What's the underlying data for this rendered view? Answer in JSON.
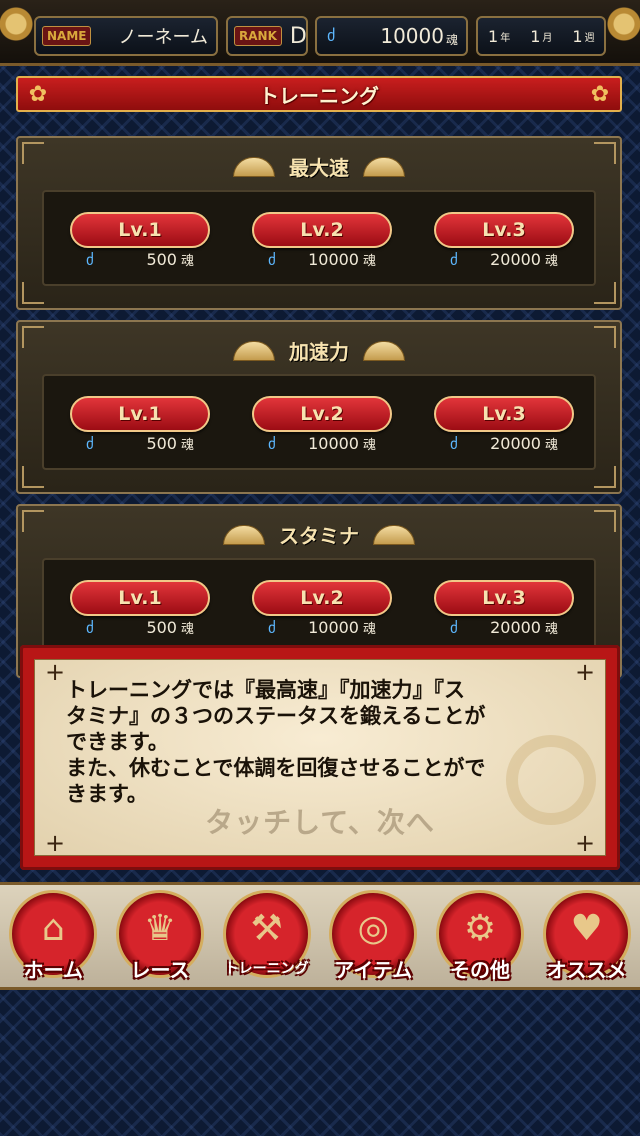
{
  "status": {
    "name_tag": "NAME",
    "name": "ノーネーム",
    "rank_tag": "RANK",
    "rank": "D",
    "souls": "10000",
    "souls_unit": "魂",
    "year": "1",
    "year_unit": "年",
    "month": "1",
    "month_unit": "月",
    "week": "1",
    "week_unit": "週"
  },
  "screen_title": "トレーニング",
  "trainings": [
    {
      "title": "最大速",
      "levels": [
        {
          "label": "Lv.1",
          "cost": "500",
          "unit": "魂"
        },
        {
          "label": "Lv.2",
          "cost": "10000",
          "unit": "魂"
        },
        {
          "label": "Lv.3",
          "cost": "20000",
          "unit": "魂"
        }
      ]
    },
    {
      "title": "加速力",
      "levels": [
        {
          "label": "Lv.1",
          "cost": "500",
          "unit": "魂"
        },
        {
          "label": "Lv.2",
          "cost": "10000",
          "unit": "魂"
        },
        {
          "label": "Lv.3",
          "cost": "20000",
          "unit": "魂"
        }
      ]
    },
    {
      "title": "スタミナ",
      "levels": [
        {
          "label": "Lv.1",
          "cost": "500",
          "unit": "魂"
        },
        {
          "label": "Lv.2",
          "cost": "10000",
          "unit": "魂"
        },
        {
          "label": "Lv.3",
          "cost": "20000",
          "unit": "魂"
        }
      ]
    }
  ],
  "tutorial": {
    "text_line1": "トレーニングでは『最高速』『加速力』『ス",
    "text_line2": "タミナ』の３つのステータスを鍛えることが",
    "text_line3": "できます。",
    "text_line4": "また、休むことで体調を回復させることがで",
    "text_line5": "きます。",
    "next_hint": "タッチして、次へ"
  },
  "nav": [
    {
      "label": "ホーム",
      "icon": "home-icon"
    },
    {
      "label": "レース",
      "icon": "trophy-icon"
    },
    {
      "label": "トレーニング",
      "icon": "dumbbell-icon"
    },
    {
      "label": "アイテム",
      "icon": "coins-icon"
    },
    {
      "label": "その他",
      "icon": "gear-icon"
    },
    {
      "label": "オススメ",
      "icon": "heart-icon"
    }
  ],
  "colors": {
    "accent_red": "#c81e1e",
    "gold": "#d4ad5e",
    "soul_blue": "#5db8ff"
  }
}
